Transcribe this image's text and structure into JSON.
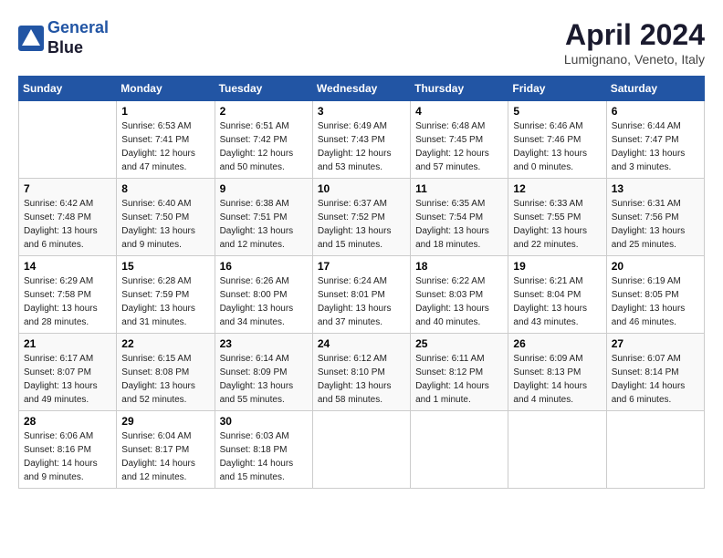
{
  "header": {
    "logo_line1": "General",
    "logo_line2": "Blue",
    "month": "April 2024",
    "location": "Lumignano, Veneto, Italy"
  },
  "weekdays": [
    "Sunday",
    "Monday",
    "Tuesday",
    "Wednesday",
    "Thursday",
    "Friday",
    "Saturday"
  ],
  "weeks": [
    [
      {
        "day": "",
        "info": ""
      },
      {
        "day": "1",
        "info": "Sunrise: 6:53 AM\nSunset: 7:41 PM\nDaylight: 12 hours\nand 47 minutes."
      },
      {
        "day": "2",
        "info": "Sunrise: 6:51 AM\nSunset: 7:42 PM\nDaylight: 12 hours\nand 50 minutes."
      },
      {
        "day": "3",
        "info": "Sunrise: 6:49 AM\nSunset: 7:43 PM\nDaylight: 12 hours\nand 53 minutes."
      },
      {
        "day": "4",
        "info": "Sunrise: 6:48 AM\nSunset: 7:45 PM\nDaylight: 12 hours\nand 57 minutes."
      },
      {
        "day": "5",
        "info": "Sunrise: 6:46 AM\nSunset: 7:46 PM\nDaylight: 13 hours\nand 0 minutes."
      },
      {
        "day": "6",
        "info": "Sunrise: 6:44 AM\nSunset: 7:47 PM\nDaylight: 13 hours\nand 3 minutes."
      }
    ],
    [
      {
        "day": "7",
        "info": "Sunrise: 6:42 AM\nSunset: 7:48 PM\nDaylight: 13 hours\nand 6 minutes."
      },
      {
        "day": "8",
        "info": "Sunrise: 6:40 AM\nSunset: 7:50 PM\nDaylight: 13 hours\nand 9 minutes."
      },
      {
        "day": "9",
        "info": "Sunrise: 6:38 AM\nSunset: 7:51 PM\nDaylight: 13 hours\nand 12 minutes."
      },
      {
        "day": "10",
        "info": "Sunrise: 6:37 AM\nSunset: 7:52 PM\nDaylight: 13 hours\nand 15 minutes."
      },
      {
        "day": "11",
        "info": "Sunrise: 6:35 AM\nSunset: 7:54 PM\nDaylight: 13 hours\nand 18 minutes."
      },
      {
        "day": "12",
        "info": "Sunrise: 6:33 AM\nSunset: 7:55 PM\nDaylight: 13 hours\nand 22 minutes."
      },
      {
        "day": "13",
        "info": "Sunrise: 6:31 AM\nSunset: 7:56 PM\nDaylight: 13 hours\nand 25 minutes."
      }
    ],
    [
      {
        "day": "14",
        "info": "Sunrise: 6:29 AM\nSunset: 7:58 PM\nDaylight: 13 hours\nand 28 minutes."
      },
      {
        "day": "15",
        "info": "Sunrise: 6:28 AM\nSunset: 7:59 PM\nDaylight: 13 hours\nand 31 minutes."
      },
      {
        "day": "16",
        "info": "Sunrise: 6:26 AM\nSunset: 8:00 PM\nDaylight: 13 hours\nand 34 minutes."
      },
      {
        "day": "17",
        "info": "Sunrise: 6:24 AM\nSunset: 8:01 PM\nDaylight: 13 hours\nand 37 minutes."
      },
      {
        "day": "18",
        "info": "Sunrise: 6:22 AM\nSunset: 8:03 PM\nDaylight: 13 hours\nand 40 minutes."
      },
      {
        "day": "19",
        "info": "Sunrise: 6:21 AM\nSunset: 8:04 PM\nDaylight: 13 hours\nand 43 minutes."
      },
      {
        "day": "20",
        "info": "Sunrise: 6:19 AM\nSunset: 8:05 PM\nDaylight: 13 hours\nand 46 minutes."
      }
    ],
    [
      {
        "day": "21",
        "info": "Sunrise: 6:17 AM\nSunset: 8:07 PM\nDaylight: 13 hours\nand 49 minutes."
      },
      {
        "day": "22",
        "info": "Sunrise: 6:15 AM\nSunset: 8:08 PM\nDaylight: 13 hours\nand 52 minutes."
      },
      {
        "day": "23",
        "info": "Sunrise: 6:14 AM\nSunset: 8:09 PM\nDaylight: 13 hours\nand 55 minutes."
      },
      {
        "day": "24",
        "info": "Sunrise: 6:12 AM\nSunset: 8:10 PM\nDaylight: 13 hours\nand 58 minutes."
      },
      {
        "day": "25",
        "info": "Sunrise: 6:11 AM\nSunset: 8:12 PM\nDaylight: 14 hours\nand 1 minute."
      },
      {
        "day": "26",
        "info": "Sunrise: 6:09 AM\nSunset: 8:13 PM\nDaylight: 14 hours\nand 4 minutes."
      },
      {
        "day": "27",
        "info": "Sunrise: 6:07 AM\nSunset: 8:14 PM\nDaylight: 14 hours\nand 6 minutes."
      }
    ],
    [
      {
        "day": "28",
        "info": "Sunrise: 6:06 AM\nSunset: 8:16 PM\nDaylight: 14 hours\nand 9 minutes."
      },
      {
        "day": "29",
        "info": "Sunrise: 6:04 AM\nSunset: 8:17 PM\nDaylight: 14 hours\nand 12 minutes."
      },
      {
        "day": "30",
        "info": "Sunrise: 6:03 AM\nSunset: 8:18 PM\nDaylight: 14 hours\nand 15 minutes."
      },
      {
        "day": "",
        "info": ""
      },
      {
        "day": "",
        "info": ""
      },
      {
        "day": "",
        "info": ""
      },
      {
        "day": "",
        "info": ""
      }
    ]
  ]
}
